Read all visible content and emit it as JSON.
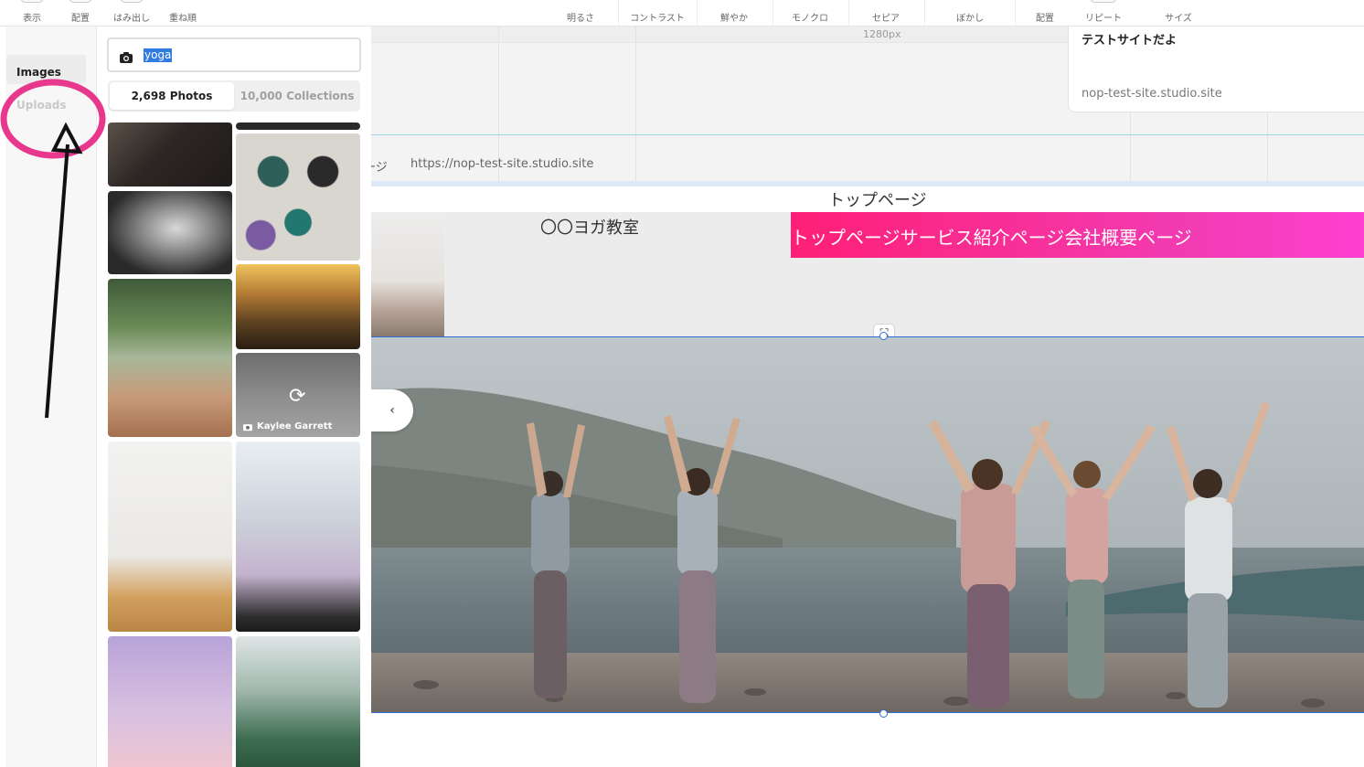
{
  "toolbar": {
    "items": [
      "表示",
      "配置",
      "はみ出し",
      "重ね順",
      "明るさ",
      "コントラスト",
      "鮮やか",
      "モノクロ",
      "セピア",
      "ぼかし",
      "配置",
      "リピート",
      "サイズ"
    ]
  },
  "left_nav": {
    "images_tab": "Images",
    "uploads_tab": "Uploads"
  },
  "image_panel": {
    "search_value": "yoga",
    "photos_tab": "2,698 Photos",
    "collections_tab": "10,000 Collections",
    "hovered_credit": "Kaylee Garrett"
  },
  "canvas": {
    "ruler_label": "1280px",
    "preview_title": "テストサイトだよ",
    "preview_url": "nop-test-site.studio.site",
    "page_label": "ージ",
    "page_url": "https://nop-test-site.studio.site",
    "page_title": "トップページ",
    "site_name": "〇〇ヨガ教室",
    "nav_text": "トップページサービス紹介ページ会社概要ページ",
    "expand_icon": "⛶",
    "prev_icon": "‹"
  },
  "colors": {
    "nav_gradient_start": "#ff1f77",
    "nav_gradient_end": "#ff3fd0",
    "annotation_circle": "#e8388e",
    "selection_blue": "#2f6fd6"
  }
}
